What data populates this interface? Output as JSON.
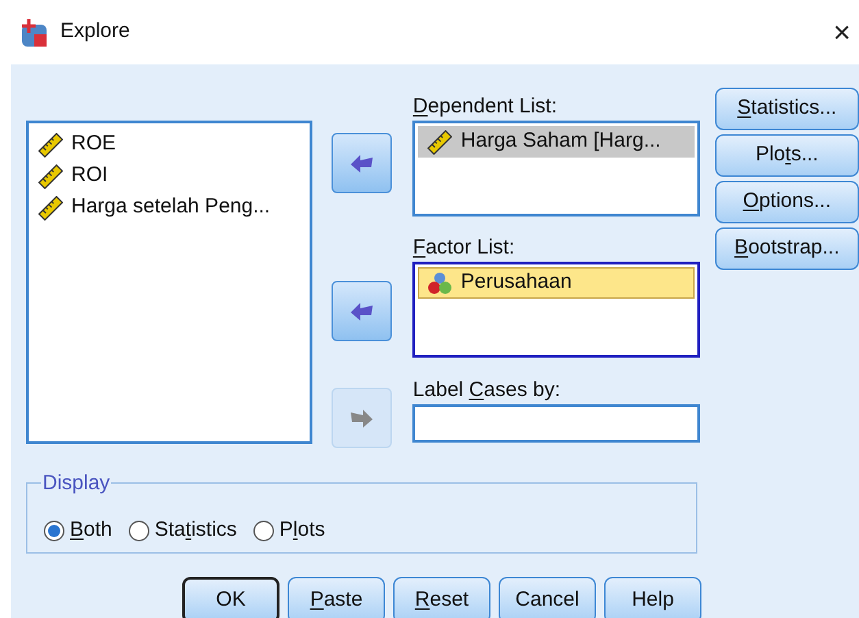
{
  "window": {
    "title": "Explore",
    "close": "×"
  },
  "source_list": {
    "items": [
      {
        "kind": "scale",
        "label": "ROE",
        "selected": false
      },
      {
        "kind": "scale",
        "label": "ROI",
        "selected": false
      },
      {
        "kind": "scale",
        "label": "Harga setelah Peng...",
        "selected": false
      }
    ]
  },
  "move_buttons": [
    {
      "kind": "left",
      "disabled": false
    },
    {
      "kind": "left",
      "disabled": false
    },
    {
      "kind": "right",
      "disabled": true
    }
  ],
  "dependent_list": {
    "label": [
      {
        "text": "D",
        "underlined": true
      },
      {
        "text": "ependent List:",
        "underlined": false
      }
    ],
    "focused": false,
    "items": [
      {
        "kind": "scale",
        "label": "Harga Saham [Harg...",
        "selected": true
      }
    ]
  },
  "factor_list": {
    "label": [
      {
        "text": "F",
        "underlined": true
      },
      {
        "text": "actor List:",
        "underlined": false
      }
    ],
    "focused": true,
    "items": [
      {
        "kind": "nominal",
        "label": "Perusahaan",
        "selected": true
      }
    ]
  },
  "label_cases": {
    "label": [
      {
        "text": "Label ",
        "underlined": false
      },
      {
        "text": "C",
        "underlined": true
      },
      {
        "text": "ases by:",
        "underlined": false
      }
    ]
  },
  "side_buttons": [
    {
      "label": [
        {
          "text": "S",
          "underlined": true
        },
        {
          "text": "tatistics...",
          "underlined": false
        }
      ]
    },
    {
      "label": [
        {
          "text": "Plo",
          "underlined": false
        },
        {
          "text": "t",
          "underlined": true
        },
        {
          "text": "s...",
          "underlined": false
        }
      ]
    },
    {
      "label": [
        {
          "text": "O",
          "underlined": true
        },
        {
          "text": "ptions...",
          "underlined": false
        }
      ]
    },
    {
      "label": [
        {
          "text": "B",
          "underlined": true
        },
        {
          "text": "ootstrap...",
          "underlined": false
        }
      ]
    }
  ],
  "display": {
    "title": "Display",
    "options": [
      {
        "label": [
          {
            "text": "B",
            "underlined": true
          },
          {
            "text": "oth",
            "underlined": false
          }
        ],
        "selected": true
      },
      {
        "label": [
          {
            "text": "Sta",
            "underlined": false
          },
          {
            "text": "t",
            "underlined": true
          },
          {
            "text": "istics",
            "underlined": false
          }
        ],
        "selected": false
      },
      {
        "label": [
          {
            "text": "P",
            "underlined": false
          },
          {
            "text": "l",
            "underlined": true
          },
          {
            "text": "ots",
            "underlined": false
          }
        ],
        "selected": false
      }
    ]
  },
  "bottom_buttons": [
    {
      "label": [
        {
          "text": "OK",
          "underlined": false
        }
      ],
      "default": true
    },
    {
      "label": [
        {
          "text": "P",
          "underlined": true
        },
        {
          "text": "aste",
          "underlined": false
        }
      ],
      "default": false
    },
    {
      "label": [
        {
          "text": "R",
          "underlined": true
        },
        {
          "text": "eset",
          "underlined": false
        }
      ],
      "default": false
    },
    {
      "label": [
        {
          "text": "Cancel",
          "underlined": false
        }
      ],
      "default": false
    },
    {
      "label": [
        {
          "text": "Help",
          "underlined": false
        }
      ],
      "default": false
    }
  ]
}
